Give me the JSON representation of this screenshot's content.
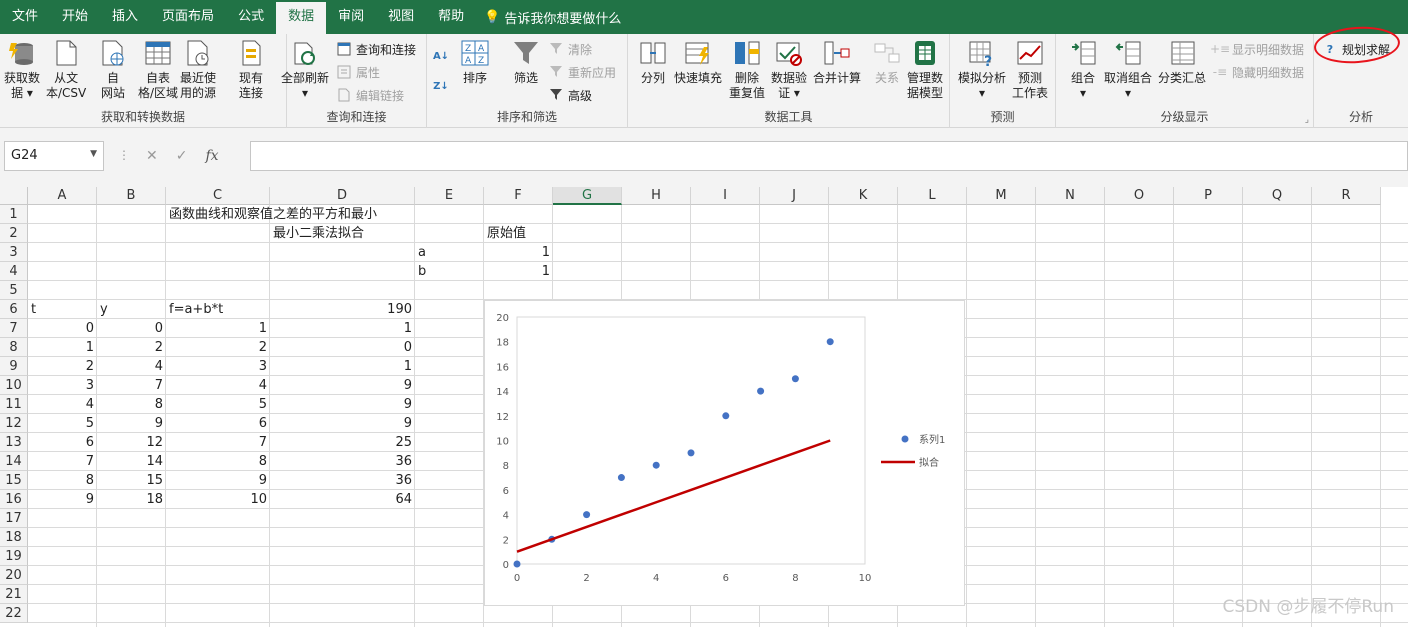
{
  "tabs": [
    "文件",
    "开始",
    "插入",
    "页面布局",
    "公式",
    "数据",
    "审阅",
    "视图",
    "帮助"
  ],
  "active_tab_index": 5,
  "tell_me": "告诉我你想要做什么",
  "ribbon": {
    "get_transform": {
      "label": "获取和转换数据",
      "get_data": "获取数\n据 ▾",
      "from_csv": "从文\n本/CSV",
      "from_web": "自\n网站",
      "from_table": "自表\n格/区域",
      "recent_sources": "最近使\n用的源",
      "existing_conn": "现有\n连接"
    },
    "queries": {
      "label": "查询和连接",
      "refresh_all": "全部刷新\n▾",
      "queries_conn": "查询和连接",
      "properties": "属性",
      "edit_links": "编辑链接"
    },
    "sort_filter": {
      "label": "排序和筛选",
      "sort": "排序",
      "filter": "筛选",
      "clear": "清除",
      "reapply": "重新应用",
      "advanced": "高级"
    },
    "data_tools": {
      "label": "数据工具",
      "text_to_columns": "分列",
      "flash_fill": "快速填充",
      "remove_dup": "删除\n重复值",
      "validation": "数据验\n证 ▾",
      "consolidate": "合并计算",
      "relationships": "关系",
      "data_model": "管理数\n据模型"
    },
    "forecast": {
      "label": "预测",
      "what_if": "模拟分析\n▾",
      "forecast_sheet": "预测\n工作表"
    },
    "outline": {
      "label": "分级显示",
      "group": "组合\n▾",
      "ungroup": "取消组合\n▾",
      "subtotal": "分类汇总",
      "show_detail": "显示明细数据",
      "hide_detail": "隐藏明细数据"
    },
    "analysis": {
      "label": "分析",
      "solver": "规划求解"
    }
  },
  "formula_bar": {
    "name_box": "G24",
    "formula": ""
  },
  "columns": [
    "A",
    "B",
    "C",
    "D",
    "E",
    "F",
    "G",
    "H",
    "I",
    "J",
    "K",
    "L",
    "M",
    "N",
    "O",
    "P",
    "Q",
    "R"
  ],
  "selected_column": "G",
  "rows": [
    "1",
    "2",
    "3",
    "4",
    "5",
    "6",
    "7",
    "8",
    "9",
    "10",
    "11",
    "12",
    "13",
    "14",
    "15",
    "16",
    "17",
    "18",
    "19",
    "20",
    "21",
    "22"
  ],
  "cells": {
    "C1": "函数曲线和观察值之差的平方和最小",
    "D2": "最小二乘法拟合",
    "F2": "原始值",
    "E3": "a",
    "F3": "1",
    "E4": "b",
    "F4": "1",
    "A6": "t",
    "B6": "y",
    "C6": "f=a+b*t",
    "D6": "190",
    "A7": "0",
    "B7": "0",
    "C7": "1",
    "D7": "1",
    "A8": "1",
    "B8": "2",
    "C8": "2",
    "D8": "0",
    "A9": "2",
    "B9": "4",
    "C9": "3",
    "D9": "1",
    "A10": "3",
    "B10": "7",
    "C10": "4",
    "D10": "9",
    "A11": "4",
    "B11": "8",
    "C11": "5",
    "D11": "9",
    "A12": "5",
    "B12": "9",
    "C12": "6",
    "D12": "9",
    "A13": "6",
    "B13": "12",
    "C13": "7",
    "D13": "25",
    "A14": "7",
    "B14": "14",
    "C14": "8",
    "D14": "36",
    "A15": "8",
    "B15": "15",
    "C15": "9",
    "D15": "36",
    "A16": "9",
    "B16": "18",
    "C16": "10",
    "D16": "64"
  },
  "chart_data": {
    "type": "scatter",
    "x": [
      0,
      1,
      2,
      3,
      4,
      5,
      6,
      7,
      8,
      9
    ],
    "series": [
      {
        "name": "系列1",
        "kind": "marker",
        "color": "#4472c4",
        "values": [
          0,
          2,
          4,
          7,
          8,
          9,
          12,
          14,
          15,
          18
        ]
      },
      {
        "name": "拟合",
        "kind": "line",
        "color": "#c00000",
        "values": [
          1,
          2,
          3,
          4,
          5,
          6,
          7,
          8,
          9,
          10
        ]
      }
    ],
    "xlim": [
      0,
      10
    ],
    "ylim": [
      0,
      20
    ],
    "xticks": [
      "0",
      "2",
      "4",
      "6",
      "8",
      "10"
    ],
    "yticks": [
      "0",
      "2",
      "4",
      "6",
      "8",
      "10",
      "12",
      "14",
      "16",
      "18",
      "20"
    ],
    "legend": "right"
  },
  "watermark": "CSDN @步履不停Run"
}
